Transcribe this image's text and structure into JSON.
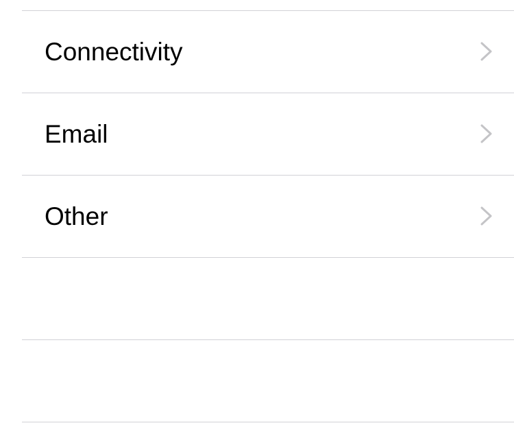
{
  "list": {
    "items": [
      {
        "label": "Connectivity",
        "icon": "chevron-right-icon"
      },
      {
        "label": "Email",
        "icon": "chevron-right-icon"
      },
      {
        "label": "Other",
        "icon": "chevron-right-icon"
      }
    ],
    "colors": {
      "separator": "#d1d1d6",
      "chevron": "#c4c4c7",
      "text": "#000000",
      "background": "#ffffff"
    }
  }
}
